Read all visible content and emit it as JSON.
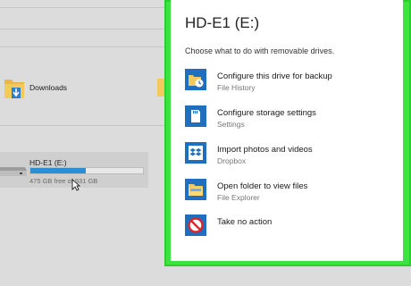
{
  "explorer": {
    "folder_label": "Downloads",
    "drive": {
      "name": "HD-E1 (E:)",
      "free_text": "475 GB free of 931 GB",
      "used_fraction": 0.49
    }
  },
  "popup": {
    "title": "HD-E1 (E:)",
    "subtitle": "Choose what to do with removable drives.",
    "options": [
      {
        "title": "Configure this drive for backup",
        "sub": "File History",
        "icon": "file-history-icon"
      },
      {
        "title": "Configure storage settings",
        "sub": "Settings",
        "icon": "sd-card-icon"
      },
      {
        "title": "Import photos and videos",
        "sub": "Dropbox",
        "icon": "dropbox-icon"
      },
      {
        "title": "Open folder to view files",
        "sub": "File Explorer",
        "icon": "folder-icon"
      },
      {
        "title": "Take no action",
        "sub": "",
        "icon": "no-action-icon"
      }
    ]
  },
  "colors": {
    "highlight_border": "#3fe23f",
    "icon_blue": "#1e6fc0",
    "drive_bar": "#2a8fd6",
    "no_action_red": "#d9262b"
  }
}
